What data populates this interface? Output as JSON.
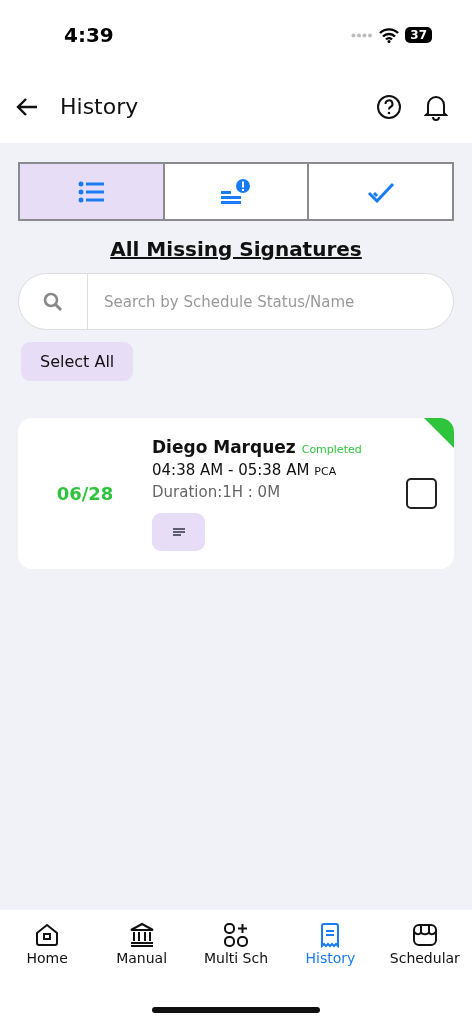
{
  "status_bar": {
    "time": "4:39",
    "battery": "37"
  },
  "header": {
    "title": "History"
  },
  "tabs": [
    {
      "kind": "list",
      "selected": true
    },
    {
      "kind": "alert",
      "selected": false
    },
    {
      "kind": "done",
      "selected": false
    }
  ],
  "section_title": "All Missing Signatures",
  "search": {
    "placeholder": "Search by Schedule Status/Name"
  },
  "select_all": "Select All",
  "schedules": [
    {
      "date": "06/28",
      "name": "Diego Marquez",
      "status": "Completed",
      "time": "04:38 AM - 05:38 AM",
      "role": "PCA",
      "duration": "Duration:1H : 0M",
      "checked": false,
      "color": "#2ec43c"
    }
  ],
  "nav": [
    {
      "kind": "home",
      "label": "Home",
      "selected": false
    },
    {
      "kind": "bank",
      "label": "Manual",
      "selected": false
    },
    {
      "kind": "grid",
      "label": "Multi Sch",
      "selected": false
    },
    {
      "kind": "receipt",
      "label": "History",
      "selected": true
    },
    {
      "kind": "store",
      "label": "Schedular",
      "selected": false
    }
  ]
}
